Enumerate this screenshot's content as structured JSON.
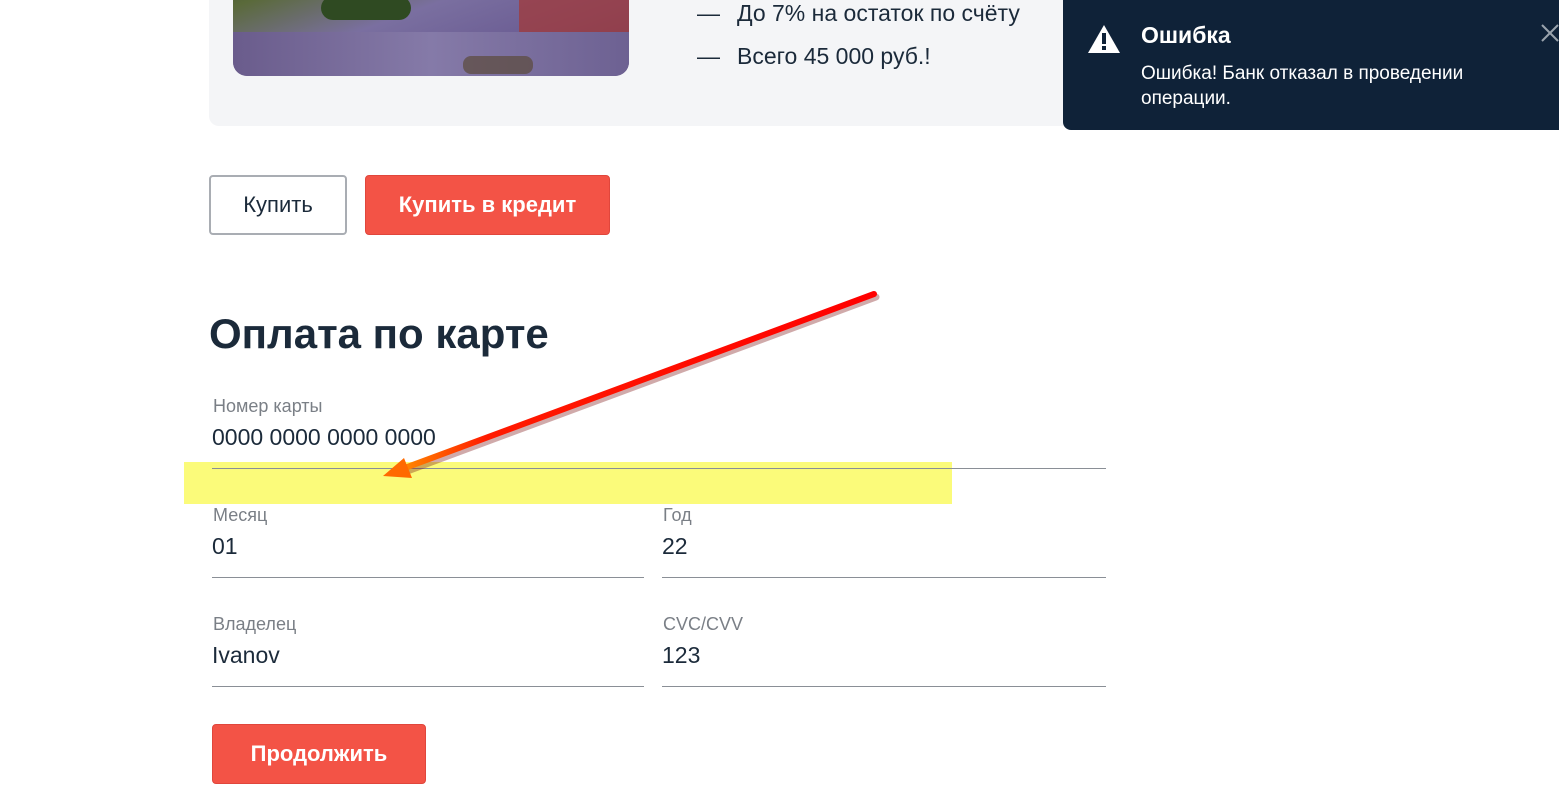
{
  "product": {
    "features": [
      "До 7% на остаток по счёту",
      "Всего 45 000 руб.!"
    ],
    "dash": "—"
  },
  "actions": {
    "buy_label": "Купить",
    "credit_label": "Купить в кредит"
  },
  "payment": {
    "title": "Оплата по карте",
    "fields": {
      "card_number": {
        "label": "Номер карты",
        "value": "0000 0000 0000 0000"
      },
      "month": {
        "label": "Месяц",
        "value": "01"
      },
      "year": {
        "label": "Год",
        "value": "22"
      },
      "owner": {
        "label": "Владелец",
        "value": "Ivanov"
      },
      "cvc": {
        "label": "CVC/CVV",
        "value": "123"
      }
    },
    "continue_label": "Продолжить"
  },
  "notification": {
    "title": "Ошибка",
    "message": "Ошибка! Банк отказал в проведении операции.",
    "icon": "warning-icon",
    "close_icon": "close-icon"
  },
  "colors": {
    "accent": "#f35346",
    "toast_bg": "#0f2238",
    "highlight": "#fbfb7a",
    "arrow": "#ff0000"
  }
}
